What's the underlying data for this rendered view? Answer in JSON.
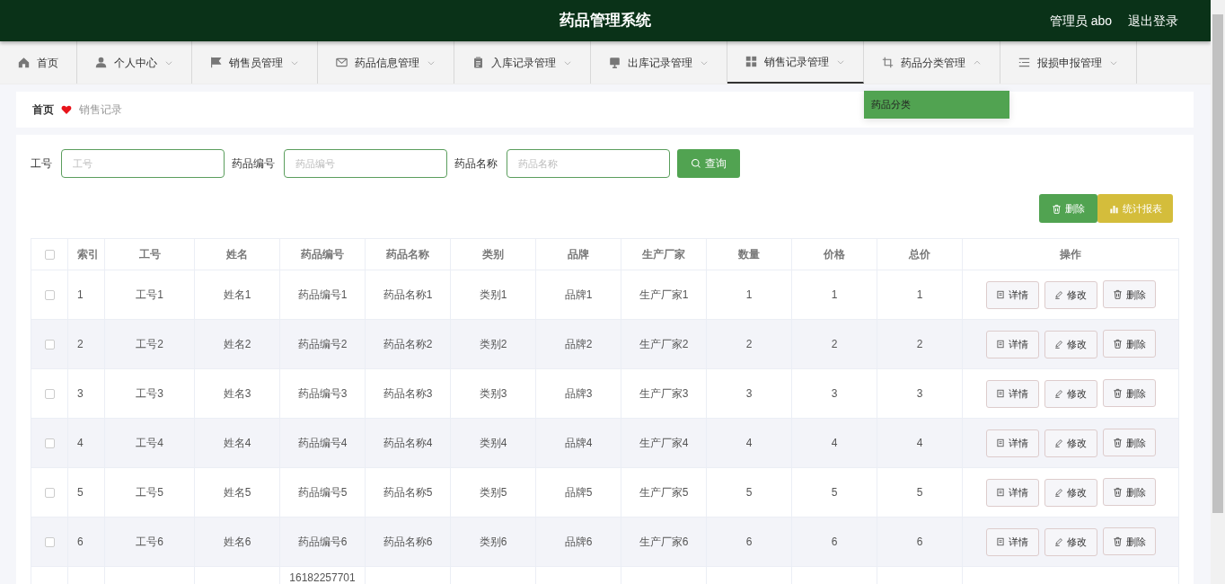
{
  "header": {
    "title": "药品管理系统",
    "user": "管理员 abo",
    "logout": "退出登录"
  },
  "nav": [
    {
      "label": "首页",
      "caret": false,
      "selected": false
    },
    {
      "label": "个人中心",
      "caret": true,
      "expanded": false,
      "selected": false
    },
    {
      "label": "销售员管理",
      "caret": true,
      "expanded": false,
      "selected": false
    },
    {
      "label": "药品信息管理",
      "caret": true,
      "expanded": false,
      "selected": false
    },
    {
      "label": "入库记录管理",
      "caret": true,
      "expanded": false,
      "selected": false
    },
    {
      "label": "出库记录管理",
      "caret": true,
      "expanded": false,
      "selected": false
    },
    {
      "label": "销售记录管理",
      "caret": true,
      "expanded": false,
      "selected": true
    },
    {
      "label": "药品分类管理",
      "caret": true,
      "expanded": true,
      "selected": false,
      "menu": [
        {
          "label": "药品分类",
          "selected": true
        }
      ]
    },
    {
      "label": "报损申报管理",
      "caret": true,
      "expanded": false,
      "selected": false
    }
  ],
  "breadcrumb": [
    "首页",
    "销售记录"
  ],
  "search": {
    "fields": [
      {
        "label": "工号",
        "placeholder": "工号"
      },
      {
        "label": "药品编号",
        "placeholder": "药品编号"
      },
      {
        "label": "药品名称",
        "placeholder": "药品名称"
      }
    ],
    "button": "查询"
  },
  "toolbar": [
    {
      "label": "删除",
      "kind": "delete"
    },
    {
      "label": "统计报表",
      "kind": "report"
    }
  ],
  "table": {
    "header_checked": false,
    "columns": [
      "索引",
      "工号",
      "姓名",
      "药品编号",
      "药品名称",
      "类别",
      "品牌",
      "生产厂家",
      "数量",
      "价格",
      "总价",
      "操作"
    ],
    "rows": [
      {
        "checked": false,
        "cells": [
          "1",
          "工号1",
          "姓名1",
          "药品编号1",
          "药品名称1",
          "类别1",
          "品牌1",
          "生产厂家1",
          "1",
          "1",
          "1"
        ],
        "actions": [
          "详情",
          "修改",
          "删除"
        ]
      },
      {
        "checked": false,
        "cells": [
          "2",
          "工号2",
          "姓名2",
          "药品编号2",
          "药品名称2",
          "类别2",
          "品牌2",
          "生产厂家2",
          "2",
          "2",
          "2"
        ],
        "actions": [
          "详情",
          "修改",
          "删除"
        ]
      },
      {
        "checked": false,
        "cells": [
          "3",
          "工号3",
          "姓名3",
          "药品编号3",
          "药品名称3",
          "类别3",
          "品牌3",
          "生产厂家3",
          "3",
          "3",
          "3"
        ],
        "actions": [
          "详情",
          "修改",
          "删除"
        ]
      },
      {
        "checked": false,
        "cells": [
          "4",
          "工号4",
          "姓名4",
          "药品编号4",
          "药品名称4",
          "类别4",
          "品牌4",
          "生产厂家4",
          "4",
          "4",
          "4"
        ],
        "actions": [
          "详情",
          "修改",
          "删除"
        ]
      },
      {
        "checked": false,
        "cells": [
          "5",
          "工号5",
          "姓名5",
          "药品编号5",
          "药品名称5",
          "类别5",
          "品牌5",
          "生产厂家5",
          "5",
          "5",
          "5"
        ],
        "actions": [
          "详情",
          "修改",
          "删除"
        ]
      },
      {
        "checked": false,
        "cells": [
          "6",
          "工号6",
          "姓名6",
          "药品编号6",
          "药品名称6",
          "类别6",
          "品牌6",
          "生产厂家6",
          "6",
          "6",
          "6"
        ],
        "actions": [
          "详情",
          "修改",
          "删除"
        ]
      },
      {
        "partial": true,
        "cells": [
          null,
          null,
          null,
          "16182257701",
          null,
          null,
          null,
          null,
          null,
          null,
          null
        ]
      }
    ]
  }
}
